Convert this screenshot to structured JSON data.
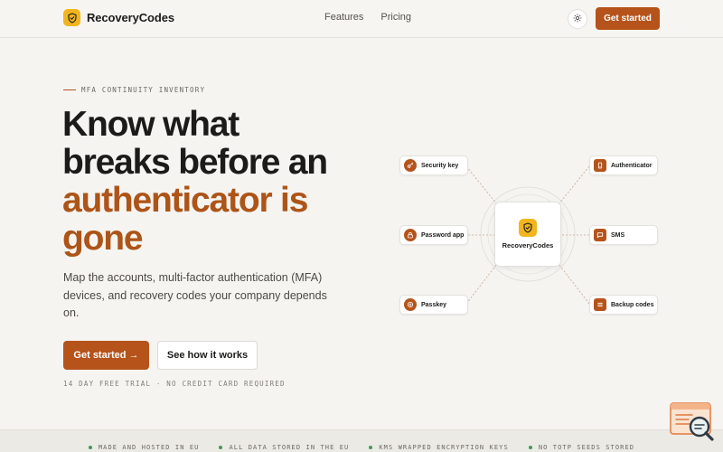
{
  "brand": {
    "name": "RecoveryCodes",
    "icon": "shield-check-icon",
    "color": "#f2b51d"
  },
  "nav": {
    "links": [
      "Features",
      "Pricing"
    ],
    "theme_icon": "sun-icon",
    "cta_label": "Get started"
  },
  "hero": {
    "eyebrow": "MFA CONTINUITY INVENTORY",
    "headline_line1": "Know what",
    "headline_line2": "breaks before an",
    "headline_accent": "authenticator is gone",
    "subtitle": "Map the accounts, multi-factor authentication (MFA) devices, and recovery codes your company depends on.",
    "primary_button": "Get started →",
    "secondary_button": "See how it works",
    "note": "14 DAY FREE TRIAL · NO CREDIT CARD REQUIRED"
  },
  "diagram": {
    "hub_label": "RecoveryCodes",
    "nodes": [
      {
        "label": "Security key",
        "icon": "key-icon"
      },
      {
        "label": "Password app",
        "icon": "lock-icon"
      },
      {
        "label": "Passkey",
        "icon": "fingerprint-icon"
      },
      {
        "label": "Authenticator",
        "icon": "phone-icon"
      },
      {
        "label": "SMS",
        "icon": "message-icon"
      },
      {
        "label": "Backup codes",
        "icon": "list-icon"
      }
    ]
  },
  "trust_strip": [
    "MADE AND HOSTED IN EU",
    "ALL DATA STORED IN THE EU",
    "KMS WRAPPED ENCRYPTION KEYS",
    "NO TOTP SEEDS STORED"
  ],
  "colors": {
    "accent": "#b5531b",
    "background": "#f5f4f1",
    "status_dot": "#3f9a55"
  }
}
